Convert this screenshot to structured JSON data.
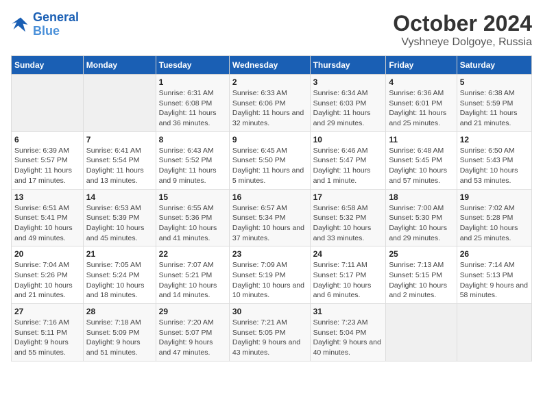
{
  "logo": {
    "line1": "General",
    "line2": "Blue"
  },
  "title": "October 2024",
  "subtitle": "Vyshneye Dolgoye, Russia",
  "days_of_week": [
    "Sunday",
    "Monday",
    "Tuesday",
    "Wednesday",
    "Thursday",
    "Friday",
    "Saturday"
  ],
  "weeks": [
    [
      {
        "day": "",
        "sunrise": "",
        "sunset": "",
        "daylight": ""
      },
      {
        "day": "",
        "sunrise": "",
        "sunset": "",
        "daylight": ""
      },
      {
        "day": "1",
        "sunrise": "Sunrise: 6:31 AM",
        "sunset": "Sunset: 6:08 PM",
        "daylight": "Daylight: 11 hours and 36 minutes."
      },
      {
        "day": "2",
        "sunrise": "Sunrise: 6:33 AM",
        "sunset": "Sunset: 6:06 PM",
        "daylight": "Daylight: 11 hours and 32 minutes."
      },
      {
        "day": "3",
        "sunrise": "Sunrise: 6:34 AM",
        "sunset": "Sunset: 6:03 PM",
        "daylight": "Daylight: 11 hours and 29 minutes."
      },
      {
        "day": "4",
        "sunrise": "Sunrise: 6:36 AM",
        "sunset": "Sunset: 6:01 PM",
        "daylight": "Daylight: 11 hours and 25 minutes."
      },
      {
        "day": "5",
        "sunrise": "Sunrise: 6:38 AM",
        "sunset": "Sunset: 5:59 PM",
        "daylight": "Daylight: 11 hours and 21 minutes."
      }
    ],
    [
      {
        "day": "6",
        "sunrise": "Sunrise: 6:39 AM",
        "sunset": "Sunset: 5:57 PM",
        "daylight": "Daylight: 11 hours and 17 minutes."
      },
      {
        "day": "7",
        "sunrise": "Sunrise: 6:41 AM",
        "sunset": "Sunset: 5:54 PM",
        "daylight": "Daylight: 11 hours and 13 minutes."
      },
      {
        "day": "8",
        "sunrise": "Sunrise: 6:43 AM",
        "sunset": "Sunset: 5:52 PM",
        "daylight": "Daylight: 11 hours and 9 minutes."
      },
      {
        "day": "9",
        "sunrise": "Sunrise: 6:45 AM",
        "sunset": "Sunset: 5:50 PM",
        "daylight": "Daylight: 11 hours and 5 minutes."
      },
      {
        "day": "10",
        "sunrise": "Sunrise: 6:46 AM",
        "sunset": "Sunset: 5:47 PM",
        "daylight": "Daylight: 11 hours and 1 minute."
      },
      {
        "day": "11",
        "sunrise": "Sunrise: 6:48 AM",
        "sunset": "Sunset: 5:45 PM",
        "daylight": "Daylight: 10 hours and 57 minutes."
      },
      {
        "day": "12",
        "sunrise": "Sunrise: 6:50 AM",
        "sunset": "Sunset: 5:43 PM",
        "daylight": "Daylight: 10 hours and 53 minutes."
      }
    ],
    [
      {
        "day": "13",
        "sunrise": "Sunrise: 6:51 AM",
        "sunset": "Sunset: 5:41 PM",
        "daylight": "Daylight: 10 hours and 49 minutes."
      },
      {
        "day": "14",
        "sunrise": "Sunrise: 6:53 AM",
        "sunset": "Sunset: 5:39 PM",
        "daylight": "Daylight: 10 hours and 45 minutes."
      },
      {
        "day": "15",
        "sunrise": "Sunrise: 6:55 AM",
        "sunset": "Sunset: 5:36 PM",
        "daylight": "Daylight: 10 hours and 41 minutes."
      },
      {
        "day": "16",
        "sunrise": "Sunrise: 6:57 AM",
        "sunset": "Sunset: 5:34 PM",
        "daylight": "Daylight: 10 hours and 37 minutes."
      },
      {
        "day": "17",
        "sunrise": "Sunrise: 6:58 AM",
        "sunset": "Sunset: 5:32 PM",
        "daylight": "Daylight: 10 hours and 33 minutes."
      },
      {
        "day": "18",
        "sunrise": "Sunrise: 7:00 AM",
        "sunset": "Sunset: 5:30 PM",
        "daylight": "Daylight: 10 hours and 29 minutes."
      },
      {
        "day": "19",
        "sunrise": "Sunrise: 7:02 AM",
        "sunset": "Sunset: 5:28 PM",
        "daylight": "Daylight: 10 hours and 25 minutes."
      }
    ],
    [
      {
        "day": "20",
        "sunrise": "Sunrise: 7:04 AM",
        "sunset": "Sunset: 5:26 PM",
        "daylight": "Daylight: 10 hours and 21 minutes."
      },
      {
        "day": "21",
        "sunrise": "Sunrise: 7:05 AM",
        "sunset": "Sunset: 5:24 PM",
        "daylight": "Daylight: 10 hours and 18 minutes."
      },
      {
        "day": "22",
        "sunrise": "Sunrise: 7:07 AM",
        "sunset": "Sunset: 5:21 PM",
        "daylight": "Daylight: 10 hours and 14 minutes."
      },
      {
        "day": "23",
        "sunrise": "Sunrise: 7:09 AM",
        "sunset": "Sunset: 5:19 PM",
        "daylight": "Daylight: 10 hours and 10 minutes."
      },
      {
        "day": "24",
        "sunrise": "Sunrise: 7:11 AM",
        "sunset": "Sunset: 5:17 PM",
        "daylight": "Daylight: 10 hours and 6 minutes."
      },
      {
        "day": "25",
        "sunrise": "Sunrise: 7:13 AM",
        "sunset": "Sunset: 5:15 PM",
        "daylight": "Daylight: 10 hours and 2 minutes."
      },
      {
        "day": "26",
        "sunrise": "Sunrise: 7:14 AM",
        "sunset": "Sunset: 5:13 PM",
        "daylight": "Daylight: 9 hours and 58 minutes."
      }
    ],
    [
      {
        "day": "27",
        "sunrise": "Sunrise: 7:16 AM",
        "sunset": "Sunset: 5:11 PM",
        "daylight": "Daylight: 9 hours and 55 minutes."
      },
      {
        "day": "28",
        "sunrise": "Sunrise: 7:18 AM",
        "sunset": "Sunset: 5:09 PM",
        "daylight": "Daylight: 9 hours and 51 minutes."
      },
      {
        "day": "29",
        "sunrise": "Sunrise: 7:20 AM",
        "sunset": "Sunset: 5:07 PM",
        "daylight": "Daylight: 9 hours and 47 minutes."
      },
      {
        "day": "30",
        "sunrise": "Sunrise: 7:21 AM",
        "sunset": "Sunset: 5:05 PM",
        "daylight": "Daylight: 9 hours and 43 minutes."
      },
      {
        "day": "31",
        "sunrise": "Sunrise: 7:23 AM",
        "sunset": "Sunset: 5:04 PM",
        "daylight": "Daylight: 9 hours and 40 minutes."
      },
      {
        "day": "",
        "sunrise": "",
        "sunset": "",
        "daylight": ""
      },
      {
        "day": "",
        "sunrise": "",
        "sunset": "",
        "daylight": ""
      }
    ]
  ]
}
